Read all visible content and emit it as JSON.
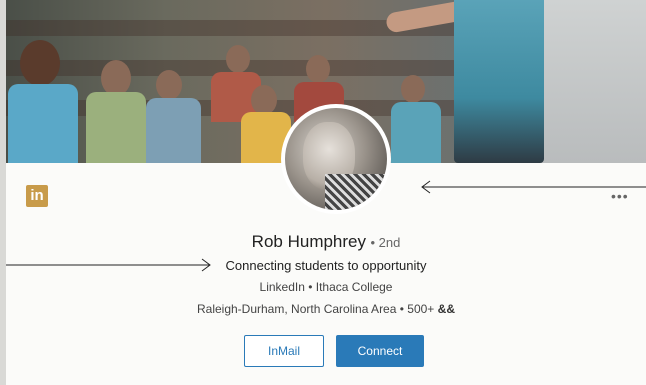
{
  "profile": {
    "name": "Rob Humphrey",
    "degree": "• 2nd",
    "headline": "Connecting students to opportunity",
    "company": "LinkedIn • Ithaca College",
    "location": "Raleigh-Durham, North Carolina Area • 500+"
  },
  "actions": {
    "inmail_label": "InMail",
    "connect_label": "Connect"
  },
  "brand": {
    "logo_text": "in",
    "accent_color": "#2a7ab8",
    "logo_color": "#c89b4a"
  },
  "icons": {
    "more": "more-options-icon",
    "connections": "connections-icon"
  }
}
